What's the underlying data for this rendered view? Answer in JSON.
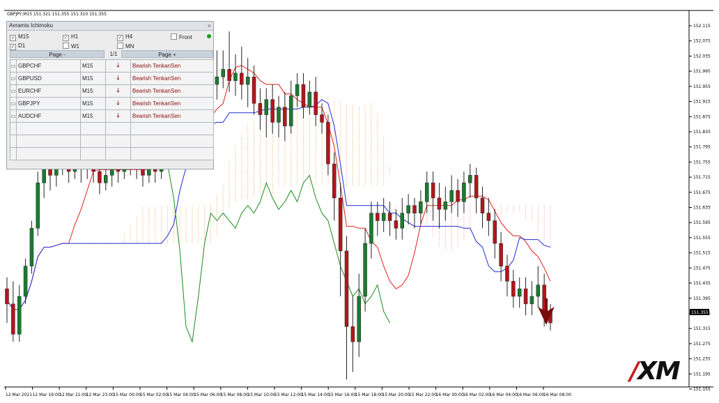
{
  "symbol_header": "GBPJPY,M15  151.321 151.355 151.310 151.355",
  "current_price": "151.355",
  "colors": {
    "bull": "#1d7a2f",
    "bear": "#b3161c",
    "tenkan": "#e0201c",
    "kijun": "#1e2bd6",
    "chikou": "#1a8a1a",
    "cloud_up": "#f2a04a",
    "cloud_down": "#f08c8c",
    "signal_arrow": "#7a0b0b"
  },
  "panel": {
    "title": "Avramis Ichimoku",
    "close": "×",
    "timeframes": [
      {
        "label": "M15",
        "checked": true
      },
      {
        "label": "H1",
        "checked": true
      },
      {
        "label": "H4",
        "checked": true
      },
      {
        "label": "Front",
        "checked": false
      },
      {
        "label": "D1",
        "checked": true
      },
      {
        "label": "W1",
        "checked": false
      },
      {
        "label": "MN",
        "checked": false
      }
    ],
    "page_prev": "Page -",
    "page_next": "Page +",
    "page_count": "1/1",
    "rows": [
      {
        "symbol": "GBPCHF",
        "tf": "M15",
        "signal": "Bearish TenkanSen"
      },
      {
        "symbol": "GBPUSD",
        "tf": "M15",
        "signal": "Bearish TenkanSen"
      },
      {
        "symbol": "EURCHF",
        "tf": "M15",
        "signal": "Bearish TenkanSen"
      },
      {
        "symbol": "GBPJPY",
        "tf": "M15",
        "signal": "Bearish TenkanSen"
      },
      {
        "symbol": "AUDCHF",
        "tf": "M15",
        "signal": "Bearish TenkanSen"
      }
    ],
    "empty_rows": 3
  },
  "chart_data": {
    "type": "candlestick",
    "y_ticks": [
      "152.115",
      "152.075",
      "152.035",
      "151.995",
      "151.955",
      "151.915",
      "151.875",
      "151.835",
      "151.795",
      "151.755",
      "151.715",
      "151.675",
      "151.635",
      "151.595",
      "151.555",
      "151.515",
      "151.475",
      "151.435",
      "151.395",
      "151.355",
      "151.315",
      "151.275",
      "151.235",
      "151.195",
      "151.155"
    ],
    "ylim": [
      151.155,
      152.115
    ],
    "x_ticks": [
      "12 Mar 2021",
      "12 Mar 19:00",
      "12 Mar 21:00",
      "12 Mar 23:00",
      "15 Mar 00:00",
      "15 Mar 02:00",
      "15 Mar 04:00",
      "15 Mar 06:00",
      "15 Mar 08:00",
      "15 Mar 10:00",
      "15 Mar 12:00",
      "15 Mar 14:00",
      "15 Mar 16:00",
      "15 Mar 18:00",
      "15 Mar 20:00",
      "15 Mar 22:00",
      "16 Mar 00:00",
      "16 Mar 02:00",
      "16 Mar 04:00",
      "16 Mar 06:00",
      "16 Mar 08:00"
    ],
    "candles": [
      [
        151.42,
        151.38,
        151.45,
        151.33
      ],
      [
        151.38,
        151.3,
        151.44,
        151.28
      ],
      [
        151.3,
        151.4,
        151.43,
        151.28
      ],
      [
        151.4,
        151.48,
        151.5,
        151.38
      ],
      [
        151.48,
        151.58,
        151.6,
        151.46
      ],
      [
        151.58,
        151.7,
        151.73,
        151.56
      ],
      [
        151.7,
        151.74,
        151.78,
        151.66
      ],
      [
        151.74,
        151.72,
        151.78,
        151.68
      ],
      [
        151.72,
        151.75,
        151.79,
        151.69
      ],
      [
        151.75,
        151.76,
        151.8,
        151.72
      ],
      [
        151.76,
        151.73,
        151.79,
        151.7
      ],
      [
        151.73,
        151.76,
        151.8,
        151.71
      ],
      [
        151.76,
        151.74,
        151.79,
        151.7
      ],
      [
        151.74,
        151.76,
        151.8,
        151.71
      ],
      [
        151.76,
        151.73,
        151.79,
        151.7
      ],
      [
        151.73,
        151.7,
        151.76,
        151.67
      ],
      [
        151.7,
        151.72,
        151.75,
        151.68
      ],
      [
        151.72,
        151.74,
        151.77,
        151.69
      ],
      [
        151.74,
        151.73,
        151.77,
        151.7
      ],
      [
        151.73,
        151.75,
        151.78,
        151.71
      ],
      [
        151.75,
        151.77,
        151.8,
        151.72
      ],
      [
        151.77,
        151.74,
        151.8,
        151.71
      ],
      [
        151.74,
        151.72,
        151.77,
        151.69
      ],
      [
        151.72,
        151.74,
        151.77,
        151.7
      ],
      [
        151.74,
        151.73,
        151.77,
        151.7
      ],
      [
        151.73,
        151.76,
        151.79,
        151.71
      ],
      [
        151.76,
        151.79,
        151.84,
        151.74
      ],
      [
        151.79,
        151.86,
        151.9,
        151.77
      ],
      [
        151.86,
        151.94,
        151.98,
        151.84
      ],
      [
        151.94,
        151.98,
        152.02,
        151.91
      ],
      [
        151.98,
        152.0,
        152.03,
        151.95
      ],
      [
        152.0,
        151.97,
        152.03,
        151.92
      ],
      [
        151.97,
        151.99,
        152.04,
        151.94
      ],
      [
        151.99,
        151.96,
        152.03,
        151.93
      ],
      [
        151.96,
        151.98,
        152.05,
        151.92
      ],
      [
        151.98,
        152.0,
        152.05,
        151.95
      ],
      [
        152.0,
        151.97,
        152.1,
        151.94
      ],
      [
        151.97,
        151.99,
        152.04,
        151.93
      ],
      [
        151.99,
        151.96,
        152.06,
        151.92
      ],
      [
        151.96,
        151.98,
        152.03,
        151.9
      ],
      [
        151.98,
        151.91,
        152.01,
        151.88
      ],
      [
        151.91,
        151.88,
        151.95,
        151.84
      ],
      [
        151.88,
        151.92,
        151.95,
        151.82
      ],
      [
        151.92,
        151.86,
        151.96,
        151.83
      ],
      [
        151.86,
        151.9,
        151.93,
        151.82
      ],
      [
        151.9,
        151.85,
        151.94,
        151.81
      ],
      [
        151.85,
        151.93,
        151.97,
        151.83
      ],
      [
        151.93,
        151.96,
        151.99,
        151.9
      ],
      [
        151.96,
        151.9,
        151.99,
        151.87
      ],
      [
        151.9,
        151.94,
        151.97,
        151.88
      ],
      [
        151.94,
        151.88,
        151.98,
        151.85
      ],
      [
        151.88,
        151.86,
        151.91,
        151.83
      ],
      [
        151.86,
        151.75,
        151.88,
        151.72
      ],
      [
        151.75,
        151.66,
        151.78,
        151.6
      ],
      [
        151.66,
        151.52,
        151.7,
        151.4
      ],
      [
        151.52,
        151.32,
        151.56,
        151.18
      ],
      [
        151.32,
        151.28,
        151.4,
        151.2
      ],
      [
        151.28,
        151.4,
        151.46,
        151.24
      ],
      [
        151.4,
        151.54,
        151.58,
        151.36
      ],
      [
        151.54,
        151.62,
        151.65,
        151.5
      ],
      [
        151.62,
        151.6,
        151.65,
        151.56
      ],
      [
        151.6,
        151.62,
        151.66,
        151.57
      ],
      [
        151.62,
        151.6,
        151.65,
        151.56
      ],
      [
        151.6,
        151.58,
        151.63,
        151.55
      ],
      [
        151.58,
        151.62,
        151.66,
        151.55
      ],
      [
        151.62,
        151.64,
        151.67,
        151.59
      ],
      [
        151.64,
        151.62,
        151.66,
        151.58
      ],
      [
        151.62,
        151.65,
        151.68,
        151.59
      ],
      [
        151.65,
        151.7,
        151.73,
        151.62
      ],
      [
        151.7,
        151.66,
        151.73,
        151.6
      ],
      [
        151.66,
        151.63,
        151.7,
        151.58
      ],
      [
        151.63,
        151.65,
        151.69,
        151.6
      ],
      [
        151.65,
        151.68,
        151.72,
        151.62
      ],
      [
        151.68,
        151.65,
        151.71,
        151.61
      ],
      [
        151.65,
        151.7,
        151.73,
        151.62
      ],
      [
        151.7,
        151.72,
        151.75,
        151.66
      ],
      [
        151.72,
        151.66,
        151.74,
        151.62
      ],
      [
        151.66,
        151.62,
        151.69,
        151.58
      ],
      [
        151.62,
        151.6,
        151.66,
        151.56
      ],
      [
        151.6,
        151.54,
        151.63,
        151.5
      ],
      [
        151.54,
        151.48,
        151.57,
        151.44
      ],
      [
        151.48,
        151.44,
        151.51,
        151.4
      ],
      [
        151.44,
        151.4,
        151.47,
        151.37
      ],
      [
        151.4,
        151.42,
        151.45,
        151.37
      ],
      [
        151.42,
        151.38,
        151.45,
        151.35
      ],
      [
        151.38,
        151.4,
        151.44,
        151.35
      ],
      [
        151.4,
        151.43,
        151.48,
        151.37
      ],
      [
        151.43,
        151.36,
        151.46,
        151.32
      ],
      [
        151.36,
        151.33,
        151.38,
        151.31
      ]
    ]
  }
}
